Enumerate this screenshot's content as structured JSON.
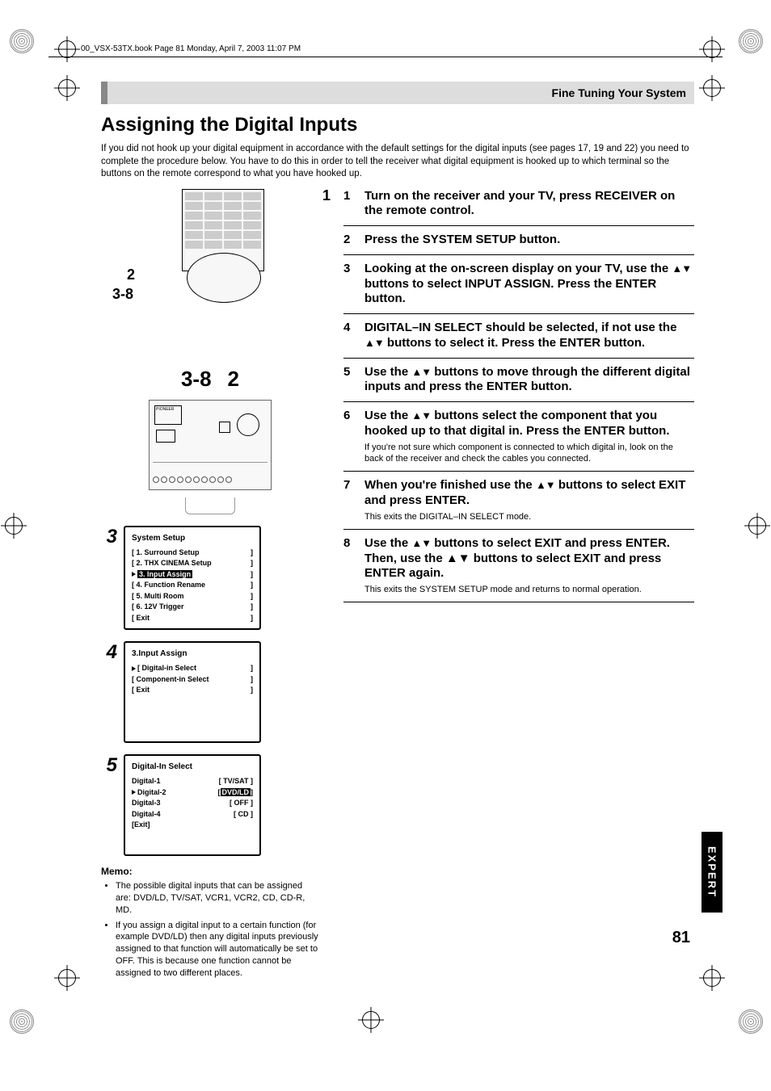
{
  "header_line": "00_VSX-53TX.book  Page 81  Monday, April 7, 2003  11:07 PM",
  "section_banner": "Fine Tuning Your System",
  "main_title": "Assigning the Digital Inputs",
  "intro": "If you did not hook up your digital equipment in accordance with the default settings for the digital inputs (see pages 17, 19 and 22) you need to complete the procedure below. You have to do this in order to tell the receiver what digital equipment is hooked up to which terminal so the buttons on the remote correspond to what you have hooked up.",
  "diagram": {
    "ref1": "1",
    "ref2": "2",
    "ref3": "3-8",
    "row_left": "3-8",
    "row_right": "2",
    "receiver_brand": "PIONEER"
  },
  "osd": {
    "3": {
      "title": "System Setup",
      "lines": [
        {
          "l": "[ 1. Surround Setup",
          "r": "]"
        },
        {
          "l": "[ 2. THX CINEMA Setup",
          "r": "]"
        },
        {
          "l": "3. Input Assign",
          "r": "]",
          "cursor": true,
          "hl": true
        },
        {
          "l": "[ 4. Function Rename",
          "r": "]"
        },
        {
          "l": "[ 5. Multi Room",
          "r": "]"
        },
        {
          "l": "[ 6. 12V Trigger",
          "r": "]"
        },
        {
          "l": "[ Exit",
          "r": "]"
        }
      ]
    },
    "4": {
      "title": "3.Input Assign",
      "lines": [
        {
          "l": "[ Digital-in Select",
          "r": "]",
          "cursor": true
        },
        {
          "l": "[ Component-in Select",
          "r": "]"
        },
        {
          "l": "[ Exit",
          "r": "]"
        }
      ]
    },
    "5": {
      "title": "Digital-In  Select",
      "lines": [
        {
          "l": "Digital-1",
          "r": "[ TV/SAT ]"
        },
        {
          "l": "Digital-2",
          "r": "DVD/LD",
          "cursor": true,
          "hl_r": true,
          "br": true
        },
        {
          "l": "Digital-3",
          "r": "[   OFF   ]"
        },
        {
          "l": "Digital-4",
          "r": "[    CD    ]"
        },
        {
          "l": "",
          "r": ""
        },
        {
          "l": "[Exit]",
          "r": ""
        }
      ]
    }
  },
  "memo": {
    "heading": "Memo:",
    "items": [
      "The possible digital inputs that can be assigned are: DVD/LD, TV/SAT, VCR1, VCR2, CD, CD-R, MD.",
      "If you assign a digital input to a certain function (for example DVD/LD) then any digital inputs previously assigned to that function will automatically be set to OFF. This is because one function cannot be assigned to two different places."
    ]
  },
  "steps": [
    {
      "n": "1",
      "title_pre": "Turn on the receiver and your TV, press RECEIVER on the remote control.",
      "sub": ""
    },
    {
      "n": "2",
      "title_pre": "Press the SYSTEM SETUP button.",
      "sub": ""
    },
    {
      "n": "3",
      "title_pre": "Looking at the on-screen display on your TV, use the ",
      "title_mid": "▲▼",
      "title_post": " buttons to select INPUT ASSIGN. Press the ENTER button.",
      "sub": ""
    },
    {
      "n": "4",
      "title_pre": "DIGITAL–IN SELECT should be selected, if not use the ",
      "title_mid": "▲▼",
      "title_post": " buttons to select it. Press the ENTER button.",
      "sub": ""
    },
    {
      "n": "5",
      "title_pre": "Use the ",
      "title_mid": "▲▼",
      "title_post": " buttons to move through the different digital inputs and press the ENTER button.",
      "sub": ""
    },
    {
      "n": "6",
      "title_pre": "Use the ",
      "title_mid": "▲▼",
      "title_post": " buttons select the component that you hooked up to that digital in. Press the ENTER button.",
      "sub": "If you're not sure which component is connected to which digital in, look on the back of the receiver and check the cables you connected."
    },
    {
      "n": "7",
      "title_pre": "When you're finished use the ",
      "title_mid": "▲▼",
      "title_post": " buttons to select EXIT and press ENTER.",
      "sub": "This exits the DIGITAL–IN SELECT mode."
    },
    {
      "n": "8",
      "title_pre": "Use the ",
      "title_mid": "▲▼",
      "title_post": " buttons to select EXIT and press ENTER. Then, use the ▲▼ buttons to select EXIT and press ENTER again.",
      "sub": "This exits the SYSTEM SETUP mode and returns to normal operation."
    }
  ],
  "side_tab": "EXPERT",
  "page_num": "81"
}
